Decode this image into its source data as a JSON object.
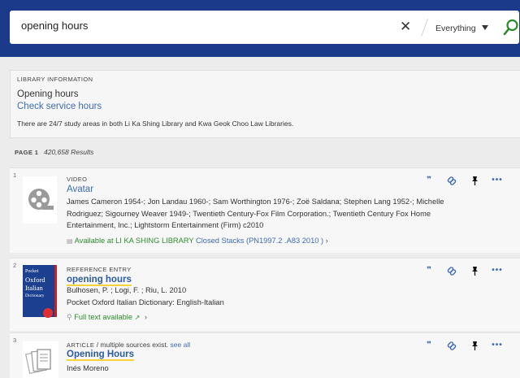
{
  "search": {
    "query": "opening hours",
    "scope": "Everything"
  },
  "info": {
    "label": "LIBRARY INFORMATION",
    "title": "Opening hours",
    "link": "Check service hours",
    "desc": "There are 24/7 study areas in both Li Ka Shing Library and Kwa Geok Choo Law Libraries."
  },
  "pagebar": {
    "page_label": "PAGE 1",
    "count": "420,658 Results"
  },
  "results": [
    {
      "num": "1",
      "type": "VIDEO",
      "title": "Avatar",
      "meta_lines": [
        "James Cameron 1954-; Jon Landau 1960-; Sam Worthington 1976-; Zoë Saldana; Stephen Lang 1952-; Michelle",
        "Rodriguez; Sigourney Weaver 1949-; Twentieth Century-Fox Film Corporation.; Twentieth Century Fox Home",
        "Entertainment, Inc.; Lightstorm Entertainment (Firm) c2010"
      ],
      "availability": "Available at LI KA SHING LIBRARY",
      "location": "Closed Stacks (PN1997.2 .A83 2010 )",
      "thumb_icon": "film-reel-icon"
    },
    {
      "num": "2",
      "type": "REFERENCE ENTRY",
      "title": "opening hours",
      "meta_lines": [
        "Bulhosen, P. ; Logi, F. ; Riu, L. 2010",
        "Pocket Oxford Italian Dictionary: English-Italian"
      ],
      "availability": "Full text available",
      "thumb_text": [
        "Pocket",
        "Oxford",
        "Italian",
        "Dictionary"
      ]
    },
    {
      "num": "3",
      "type": "ARTICLE",
      "type_extra": " / multiple sources exist.",
      "type_link": "see all",
      "title": "Opening Hours",
      "meta_lines": [
        "Inés Moreno"
      ],
      "thumb_icon": "article-pages-icon"
    }
  ],
  "actions": {
    "cite": "❞",
    "link": "link-icon",
    "pin": "pin-icon",
    "more": "•••"
  },
  "colors": {
    "header": "#1b3a8a",
    "link": "#3f6bb5",
    "available": "#2e8b2e",
    "highlight": "#f6d33b"
  }
}
